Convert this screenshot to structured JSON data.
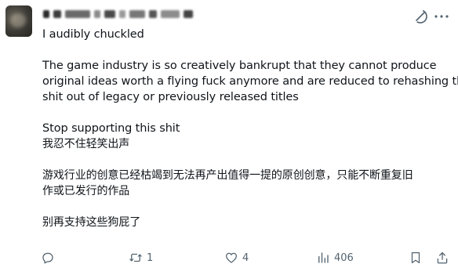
{
  "post": {
    "lines": [
      "I audibly chuckled",
      "",
      "The game industry is so creatively bankrupt that they cannot produce",
      "original ideas worth a flying fuck anymore and are reduced to rehashing the",
      "shit out of legacy or previously released titles",
      "",
      "Stop supporting this shit",
      "我忍不住轻笑出声",
      "",
      "游戏行业的创意已经枯竭到无法再产出值得一提的原创创意，只能不断重复旧",
      "作或已发行的作品",
      "",
      "别再支持这些狗屁了"
    ]
  },
  "actions": {
    "reply_count": "",
    "repost_count": "1",
    "like_count": "4",
    "views_count": "406"
  },
  "icons": {
    "reply": "reply-icon",
    "repost": "repost-icon",
    "like": "heart-icon",
    "views": "views-chart-icon",
    "bookmark": "bookmark-icon",
    "share": "share-icon",
    "grok": "grok-icon",
    "more": "more-options-icon"
  },
  "colors": {
    "text": "#0f1419",
    "muted": "#536471"
  }
}
